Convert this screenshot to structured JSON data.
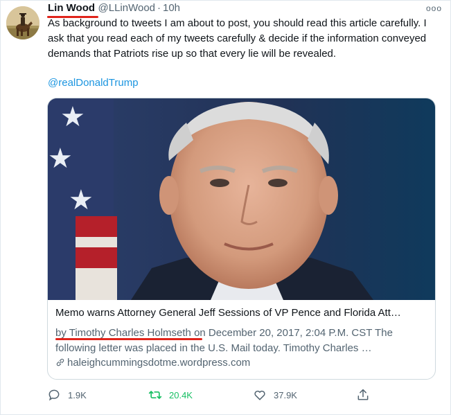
{
  "tweet": {
    "display_name": "Lin Wood",
    "handle": "@LLinWood",
    "separator": "·",
    "time": "10h",
    "more_label": "ooo",
    "text": "As background to tweets I am about to post, you should read this article carefully. I ask that you read each of my tweets carefully & decide if the information conveyed demands that Patriots rise up so that every lie will be revealed.",
    "mention": "@realDonaldTrump"
  },
  "card": {
    "title": "Memo warns Attorney General Jeff Sessions of VP Pence and Florida Att…",
    "description": "by Timothy Charles Holmseth on December 20, 2017, 2:04 P.M. CST The following letter was placed in the U.S. Mail today. Timothy Charles …",
    "domain": "haleighcummingsdotme.wordpress.com"
  },
  "actions": {
    "reply_count": "1.9K",
    "retweet_count": "20.4K",
    "like_count": "37.9K"
  },
  "colors": {
    "link": "#1b95e0",
    "retweet": "#17bf63",
    "annotation": "#e0241b",
    "muted": "#536471"
  },
  "icons": [
    "reply-icon",
    "retweet-icon",
    "like-icon",
    "share-icon",
    "link-icon",
    "more-icon"
  ]
}
